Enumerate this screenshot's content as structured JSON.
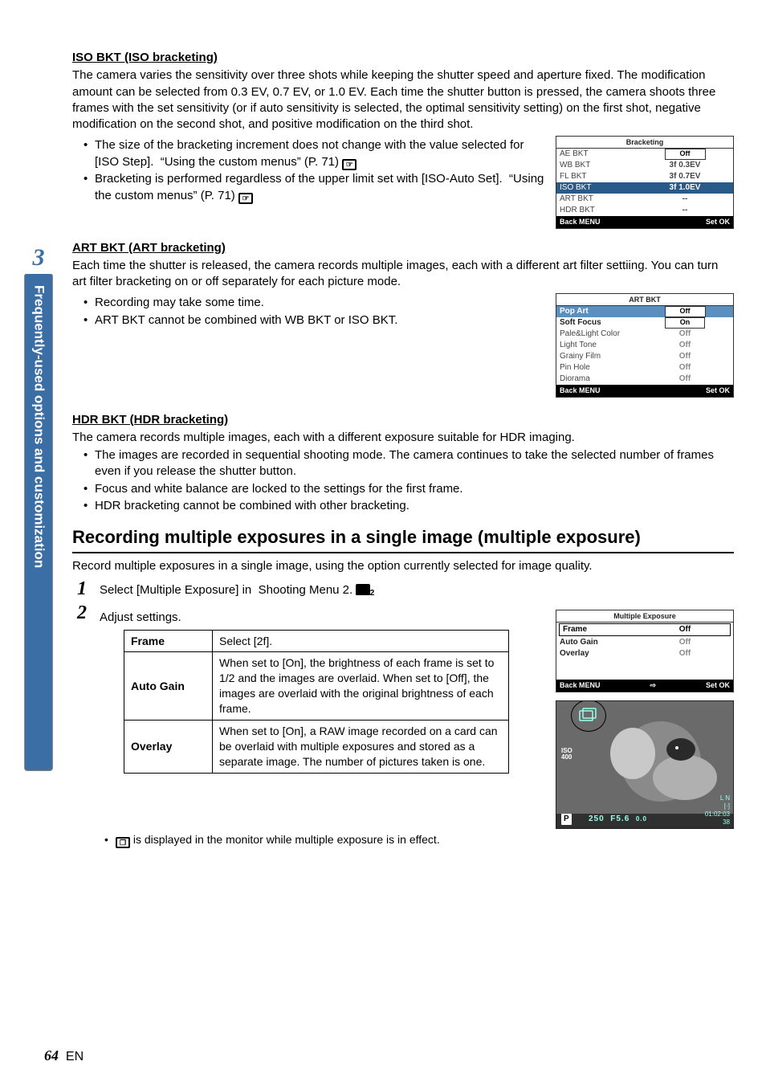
{
  "sidebar": {
    "chapter_number": "3",
    "title": "Frequently-used options and customization"
  },
  "iso_section": {
    "heading": "ISO BKT (ISO bracketing)",
    "desc": "The camera varies the sensitivity over three shots while keeping the shutter speed and aperture fixed. The modification amount can be selected from 0.3 EV, 0.7 EV, or 1.0 EV. Each time the shutter button is pressed, the camera shoots three frames with the set sensitivity (or if auto sensitivity is selected, the optimal sensitivity setting) on the first shot, negative modification on the second shot, and positive modification on the third shot.",
    "bullets": [
      "The size of the bracketing increment does not change with the value selected for [ISO Step].  “Using the custom menus” (P. 71)",
      "Bracketing is performed regardless of the upper limit set with [ISO-Auto Set].  “Using the custom menus” (P. 71)"
    ],
    "menu": {
      "title": "Bracketing",
      "rows": [
        {
          "label": "AE BKT",
          "value": "Off"
        },
        {
          "label": "WB BKT",
          "value": "3f 0.3EV"
        },
        {
          "label": "FL BKT",
          "value": "3f 0.7EV"
        },
        {
          "label": "ISO BKT",
          "value": "3f 1.0EV",
          "selected": true
        },
        {
          "label": "ART BKT",
          "value": "--"
        },
        {
          "label": "HDR BKT",
          "value": "--"
        }
      ],
      "back": "Back MENU",
      "set": "Set OK"
    }
  },
  "art_section": {
    "heading": "ART BKT (ART bracketing)",
    "desc": "Each time the shutter is released, the camera records multiple images, each with a different art filter settiing. You can turn art filter bracketing on or off separately for each picture mode.",
    "bullets": [
      "Recording may take some time.",
      "ART BKT cannot be combined with WB BKT or ISO BKT."
    ],
    "menu": {
      "title": "ART BKT",
      "rows": [
        {
          "label": "Pop Art",
          "value": "Off",
          "highlighted": true
        },
        {
          "label": "Soft Focus",
          "value": "On",
          "boxed": true
        },
        {
          "label": "Pale&Light Color",
          "value": "Off"
        },
        {
          "label": "Light Tone",
          "value": "Off"
        },
        {
          "label": "Grainy Film",
          "value": "Off"
        },
        {
          "label": "Pin Hole",
          "value": "Off"
        },
        {
          "label": "Diorama",
          "value": "Off"
        }
      ],
      "back": "Back MENU",
      "set": "Set OK"
    }
  },
  "hdr_section": {
    "heading": "HDR BKT (HDR bracketing)",
    "desc": "The camera records multiple images, each with a different exposure suitable for HDR imaging.",
    "bullets": [
      "The images are recorded in sequential shooting mode. The camera continues to take the selected number of frames even if you release the shutter button.",
      "Focus and white balance are locked to the settings for the first frame.",
      "HDR bracketing cannot be combined with other bracketing."
    ]
  },
  "me_section": {
    "heading": "Recording multiple exposures in a single image (multiple exposure)",
    "desc": "Record multiple exposures in a single image, using the option currently selected for image quality.",
    "step1": "Select [Multiple Exposure] in  Shooting Menu 2.",
    "step2": "Adjust settings.",
    "table": [
      {
        "name": "Frame",
        "desc": "Select [2f]."
      },
      {
        "name": "Auto Gain",
        "desc": "When set to [On], the brightness of each frame is set to 1/2 and the images are overlaid. When set to [Off], the images are overlaid with the original brightness of each frame."
      },
      {
        "name": "Overlay",
        "desc": "When set to [On], a RAW image recorded on a card can be overlaid with multiple exposures and stored as a separate image. The number of pictures taken is one."
      }
    ],
    "menu": {
      "title": "Multiple Exposure",
      "rows": [
        {
          "label": "Frame",
          "value": "Off",
          "highlighted": true
        },
        {
          "label": "Auto Gain",
          "value": "Off"
        },
        {
          "label": "Overlay",
          "value": "Off"
        }
      ],
      "back": "Back MENU",
      "mid": "⇨",
      "set": "Set OK"
    },
    "monitor": {
      "iso_label": "ISO",
      "iso_value": "400",
      "mode": "P",
      "shutter": "250",
      "fnum": "F5.6",
      "ev": "0.0",
      "quality": "L N",
      "af": "[·]",
      "time": "01:02:03",
      "frames": "38"
    },
    "footnote": "is displayed in the monitor while multiple exposure is in effect."
  },
  "page": {
    "number": "64",
    "lang": "EN"
  }
}
